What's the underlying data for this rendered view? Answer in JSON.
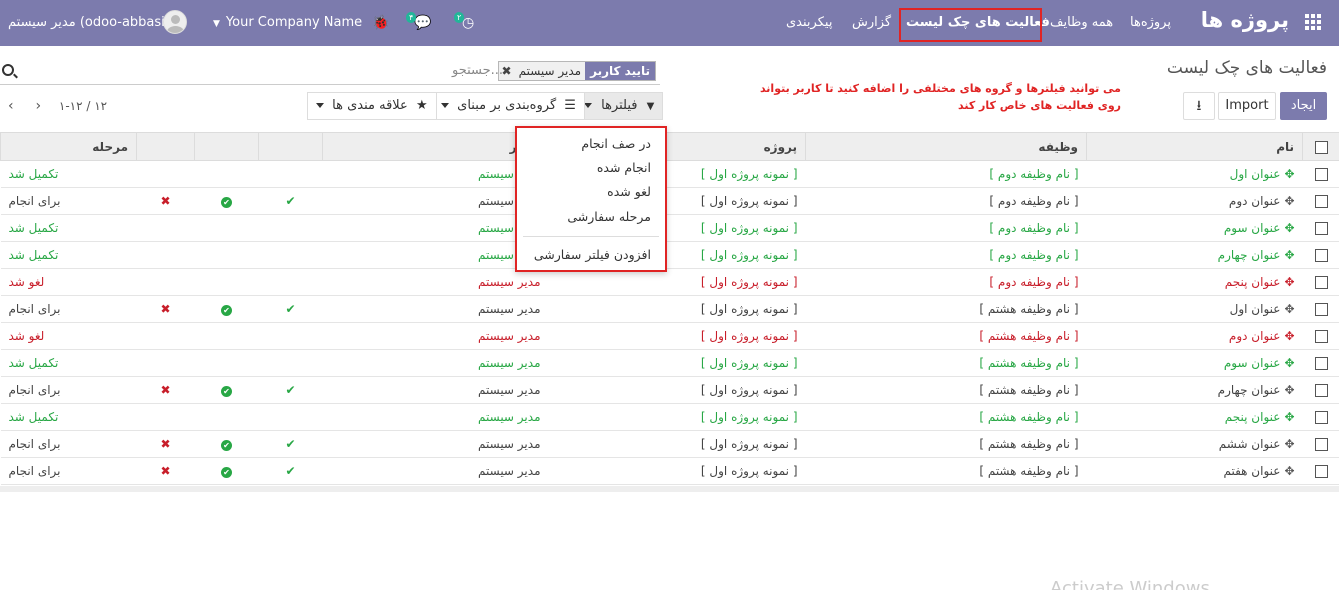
{
  "navbar": {
    "brand": "پروژه ها",
    "menu": [
      "پروژه‌ها",
      "همه وظایف",
      "فعالیت های چک لیست",
      "گزارش",
      "پیکربندی"
    ],
    "company": "Your Company Name",
    "user": "مدیر سیستم (odoo-abbasi)",
    "messages_badge": "۴",
    "activities_badge": "۲"
  },
  "control": {
    "title": "فعالیت های چک لیست",
    "facet_label": "تایید کاربر",
    "facet_value": "مدیر سیستم",
    "facet_remove": "✖",
    "search_placeholder": "جستجو...",
    "note": "می توانید فیلترها و گروه های مختلفی را اضافه کنید تا کاربر بتواند روی فعالیت های خاص کار کند",
    "create_label": "ایجاد",
    "import_label": "Import",
    "filters_label": "فیلترها",
    "groupby_label": "گروه‌بندی بر مبنای",
    "favorites_label": "علاقه مندی ها",
    "pager": "۱-۱۲ / ۱۲"
  },
  "filters_menu": {
    "items": [
      "در صف انجام",
      "انجام شده",
      "لغو شده",
      "مرحله سفارشی"
    ],
    "add_custom": "افزودن فیلتر سفارشی"
  },
  "table": {
    "headers": {
      "name": "نام",
      "task": "وظیفه",
      "project": "پروژه",
      "user": "کاربر",
      "stage": "مرحله"
    },
    "rows": [
      {
        "name": "عنوان اول",
        "task": "[ نام وظیفه دوم ]",
        "project": "[ نمونه پروژه اول ]",
        "user": "مدیر سیستم",
        "stage": "تکمیل شد",
        "status": "green",
        "actions": false
      },
      {
        "name": "عنوان دوم",
        "task": "[ نام وظیفه دوم ]",
        "project": "[ نمونه پروژه اول ]",
        "user": "مدیر سیستم",
        "stage": "برای انجام",
        "status": "plain",
        "actions": true
      },
      {
        "name": "عنوان سوم",
        "task": "[ نام وظیفه دوم ]",
        "project": "[ نمونه پروژه اول ]",
        "user": "مدیر سیستم",
        "stage": "تکمیل شد",
        "status": "green",
        "actions": false
      },
      {
        "name": "عنوان چهارم",
        "task": "[ نام وظیفه دوم ]",
        "project": "[ نمونه پروژه اول ]",
        "user": "مدیر سیستم",
        "stage": "تکمیل شد",
        "status": "green",
        "actions": false
      },
      {
        "name": "عنوان پنجم",
        "task": "[ نام وظیفه دوم ]",
        "project": "[ نمونه پروژه اول ]",
        "user": "مدیر سیستم",
        "stage": "لغو شد",
        "status": "red",
        "actions": false
      },
      {
        "name": "عنوان اول",
        "task": "[ نام وظیفه هشتم ]",
        "project": "[ نمونه پروژه اول ]",
        "user": "مدیر سیستم",
        "stage": "برای انجام",
        "status": "plain",
        "actions": true
      },
      {
        "name": "عنوان دوم",
        "task": "[ نام وظیفه هشتم ]",
        "project": "[ نمونه پروژه اول ]",
        "user": "مدیر سیستم",
        "stage": "لغو شد",
        "status": "red",
        "actions": false
      },
      {
        "name": "عنوان سوم",
        "task": "[ نام وظیفه هشتم ]",
        "project": "[ نمونه پروژه اول ]",
        "user": "مدیر سیستم",
        "stage": "تکمیل شد",
        "status": "green",
        "actions": false
      },
      {
        "name": "عنوان چهارم",
        "task": "[ نام وظیفه هشتم ]",
        "project": "[ نمونه پروژه اول ]",
        "user": "مدیر سیستم",
        "stage": "برای انجام",
        "status": "plain",
        "actions": true
      },
      {
        "name": "عنوان پنجم",
        "task": "[ نام وظیفه هشتم ]",
        "project": "[ نمونه پروژه اول ]",
        "user": "مدیر سیستم",
        "stage": "تکمیل شد",
        "status": "green",
        "actions": false
      },
      {
        "name": "عنوان ششم",
        "task": "[ نام وظیفه هشتم ]",
        "project": "[ نمونه پروژه اول ]",
        "user": "مدیر سیستم",
        "stage": "برای انجام",
        "status": "plain",
        "actions": true
      },
      {
        "name": "عنوان هفتم",
        "task": "[ نام وظیفه هشتم ]",
        "project": "[ نمونه پروژه اول ]",
        "user": "مدیر سیستم",
        "stage": "برای انجام",
        "status": "plain",
        "actions": true
      }
    ]
  },
  "watermark": "Activate Windows",
  "colors": {
    "brand": "#7c7bad",
    "green": "#28a745",
    "red": "#c81e2a",
    "highlight": "#e02424"
  }
}
